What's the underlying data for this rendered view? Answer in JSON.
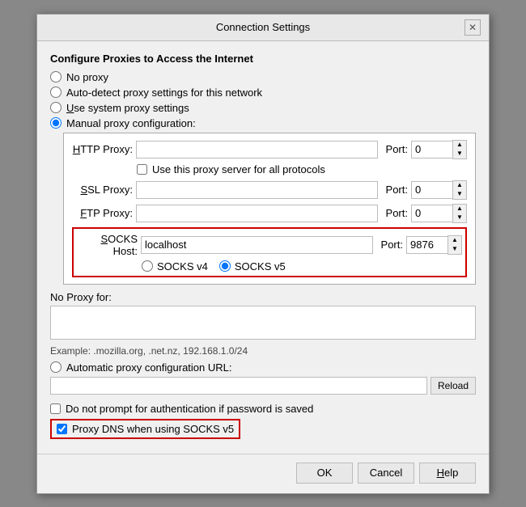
{
  "dialog": {
    "title": "Connection Settings",
    "close_label": "✕"
  },
  "section": {
    "configure_title": "Configure Proxies to Access the Internet"
  },
  "proxy_options": [
    {
      "id": "no-proxy",
      "label": "No proxy",
      "checked": false
    },
    {
      "id": "auto-detect",
      "label": "Auto-detect proxy settings for this network",
      "checked": false
    },
    {
      "id": "system-proxy",
      "label": "Use system proxy settings",
      "checked": false
    },
    {
      "id": "manual-proxy",
      "label": "Manual proxy configuration:",
      "checked": true
    }
  ],
  "http_proxy": {
    "label": "HTTP Proxy:",
    "value": "",
    "placeholder": "",
    "port_label": "Port:",
    "port_value": "0"
  },
  "use_proxy_checkbox": {
    "label": "Use this proxy server for all protocols",
    "checked": false
  },
  "ssl_proxy": {
    "label": "SSL Proxy:",
    "value": "",
    "placeholder": "",
    "port_label": "Port:",
    "port_value": "0"
  },
  "ftp_proxy": {
    "label": "FTP Proxy:",
    "value": "",
    "placeholder": "",
    "port_label": "Port:",
    "port_value": "0"
  },
  "socks_host": {
    "label": "SOCKS Host:",
    "value": "localhost",
    "placeholder": "",
    "port_label": "Port:",
    "port_value": "9876"
  },
  "socks_versions": [
    {
      "id": "socks4",
      "label": "SOCKS v4",
      "checked": false
    },
    {
      "id": "socks5",
      "label": "SOCKS v5",
      "checked": true
    }
  ],
  "no_proxy": {
    "label": "No Proxy for:",
    "value": ""
  },
  "example_text": "Example: .mozilla.org, .net.nz, 192.168.1.0/24",
  "auto_proxy": {
    "label": "Automatic proxy configuration URL:",
    "value": "",
    "reload_label": "Reload"
  },
  "bottom_checkboxes": {
    "no_auth_label": "Do not prompt for authentication if password is saved",
    "no_auth_checked": false,
    "proxy_dns_label": "Proxy DNS when using SOCKS v5",
    "proxy_dns_checked": true
  },
  "buttons": {
    "ok": "OK",
    "cancel": "Cancel",
    "help": "Help"
  },
  "underlines": {
    "http": "H",
    "ssl": "S",
    "ftp": "F",
    "socks": "S",
    "system": "U",
    "help": "H"
  }
}
